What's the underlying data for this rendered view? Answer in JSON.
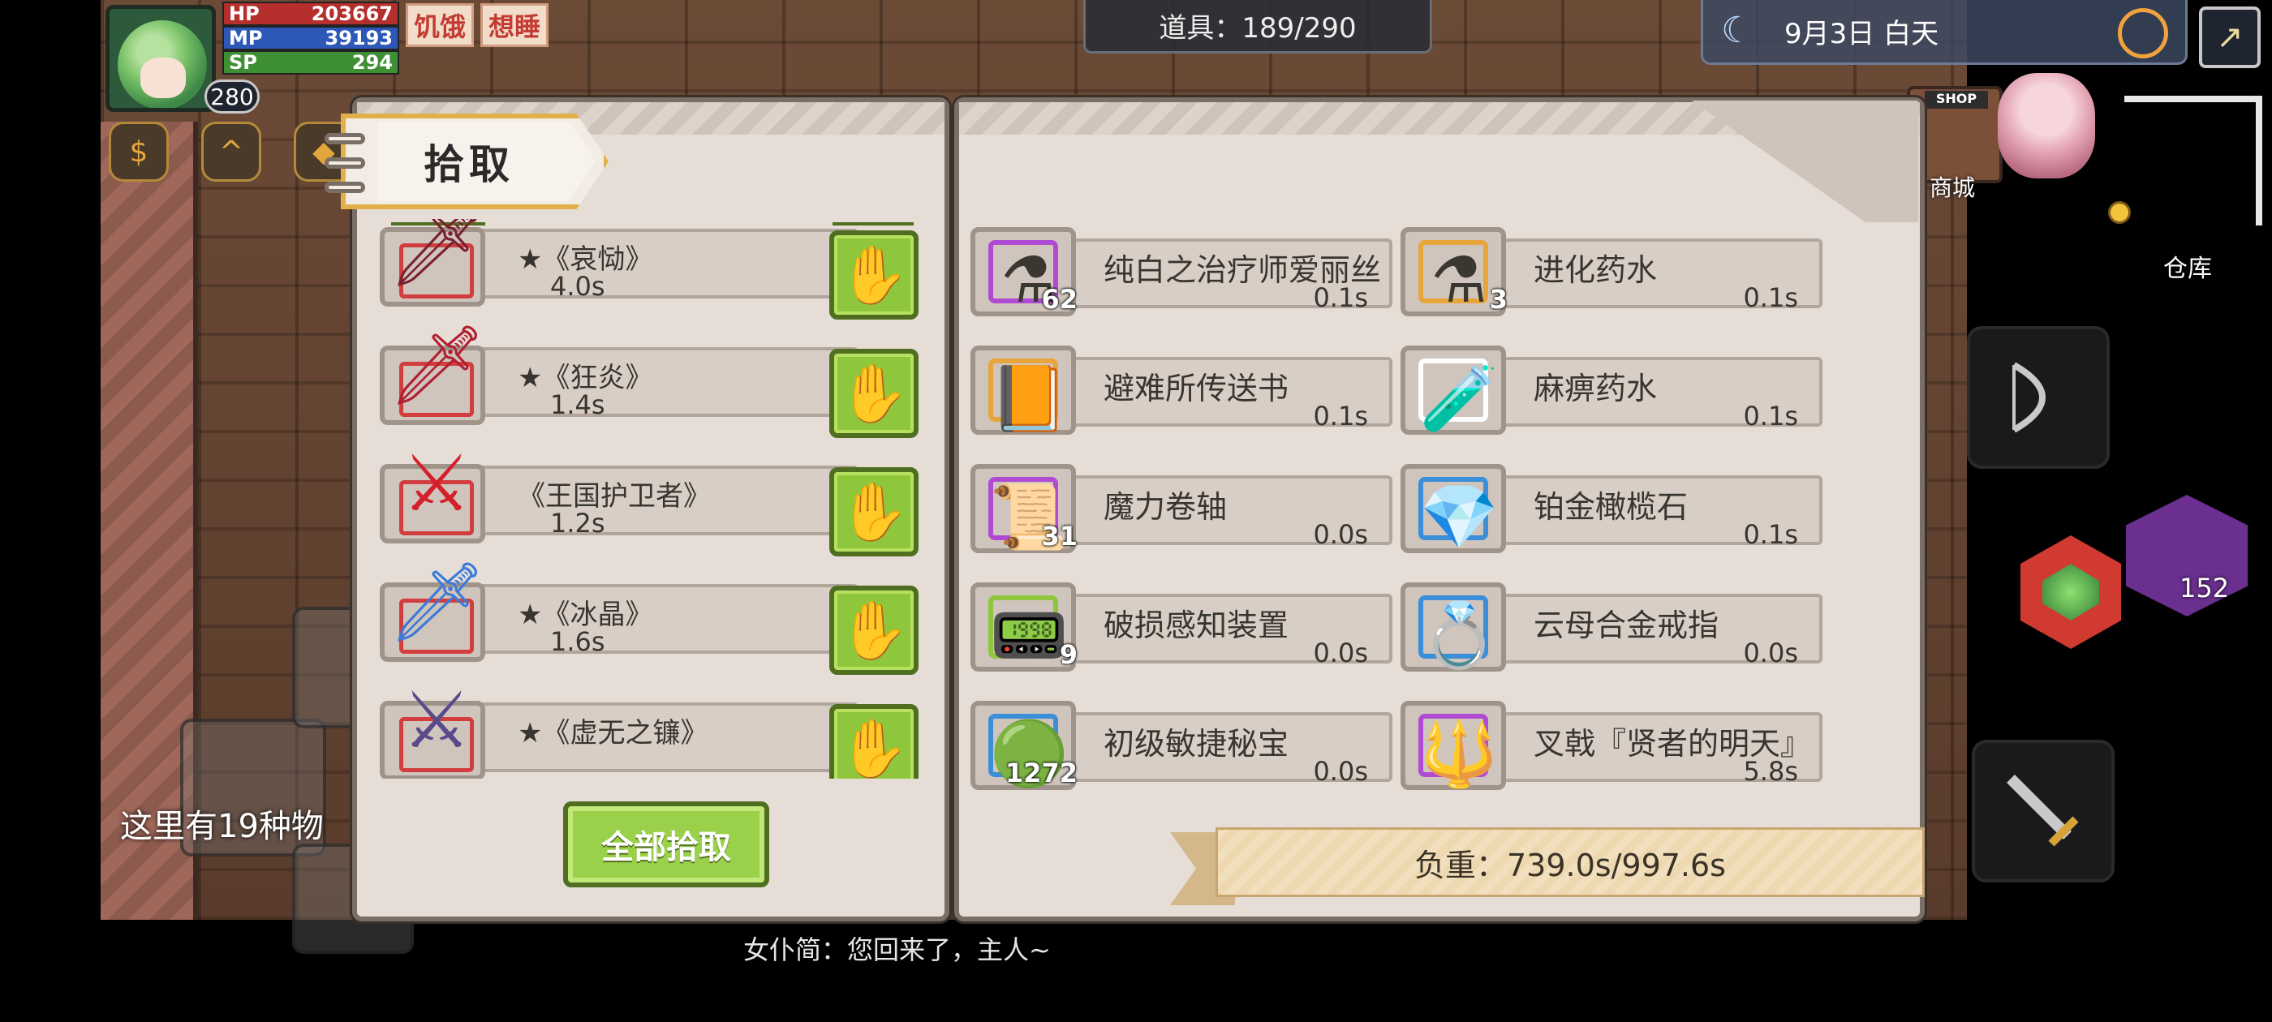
{
  "hud": {
    "hp_label": "HP",
    "hp_value": "203667",
    "mp_label": "MP",
    "mp_value": "39193",
    "sp_label": "SP",
    "sp_value": "294",
    "level": "280",
    "status_tags": [
      "饥饿",
      "想睡"
    ]
  },
  "top_bar": {
    "inventory_count": "道具：189/290",
    "date": "9月3日  白天"
  },
  "right_hud": {
    "shop_sign": "SHOP",
    "shop_label": "商城",
    "warehouse_label": "仓库",
    "bag_count": "152"
  },
  "pickup_panel": {
    "title": "拾取",
    "pick_all_label": "全部拾取",
    "weapons": [
      {
        "name": "★《哀恸》",
        "weight": "4.0s",
        "icon": "scythe-sword-icon",
        "art": "🗡"
      },
      {
        "name": "★《狂炎》",
        "weight": "1.4s",
        "icon": "flame-sword-icon",
        "art": "🗡"
      },
      {
        "name": "《王国护卫者》",
        "weight": "1.2s",
        "icon": "red-halberd-icon",
        "art": "⚔"
      },
      {
        "name": "★《冰晶》",
        "weight": "1.6s",
        "icon": "ice-sword-icon",
        "art": "🗡"
      },
      {
        "name": "★《虚无之镰》",
        "weight": "",
        "icon": "void-scythe-icon",
        "art": "⚔"
      }
    ]
  },
  "items_panel": {
    "items": [
      {
        "name": "纯白之治疗师爱丽丝",
        "weight": "0.1s",
        "count": "62",
        "icon": "white-potion-icon",
        "ring": "#b04ad2",
        "art": "⚗"
      },
      {
        "name": "进化药水",
        "weight": "0.1s",
        "count": "3",
        "icon": "purple-potion-icon",
        "ring": "#e8a53a",
        "art": "⚗"
      },
      {
        "name": "避难所传送书",
        "weight": "0.1s",
        "count": "",
        "icon": "teleport-book-icon",
        "ring": "#e8a53a",
        "art": "📙"
      },
      {
        "name": "麻痹药水",
        "weight": "0.1s",
        "count": "",
        "icon": "green-potion-icon",
        "ring": "#ffffff",
        "art": "🧪"
      },
      {
        "name": "魔力卷轴",
        "weight": "0.0s",
        "count": "31",
        "icon": "magic-scroll-icon",
        "ring": "#b04ad2",
        "art": "📜"
      },
      {
        "name": "铂金橄榄石",
        "weight": "0.1s",
        "count": "",
        "icon": "peridot-gem-icon",
        "ring": "#3a8fd8",
        "art": "💎"
      },
      {
        "name": "破损感知装置",
        "weight": "0.0s",
        "count": "9",
        "icon": "sensor-device-icon",
        "ring": "#8ec63c",
        "art": "📟"
      },
      {
        "name": "云母合金戒指",
        "weight": "0.0s",
        "count": "",
        "icon": "alloy-ring-icon",
        "ring": "#3a8fd8",
        "art": "💍"
      },
      {
        "name": "初级敏捷秘宝",
        "weight": "0.0s",
        "count": "1272",
        "icon": "agility-gem-icon",
        "ring": "#3a8fd8",
        "art": "🟢"
      },
      {
        "name": "叉戟『贤者的明天』",
        "weight": "5.8s",
        "count": "",
        "icon": "trident-icon",
        "ring": "#b04ad2",
        "art": "🔱"
      }
    ],
    "load": "负重：739.0s/997.6s"
  },
  "world": {
    "info_text": "这里有19种物",
    "chat_line": "女仆简：您回来了，主人~"
  }
}
